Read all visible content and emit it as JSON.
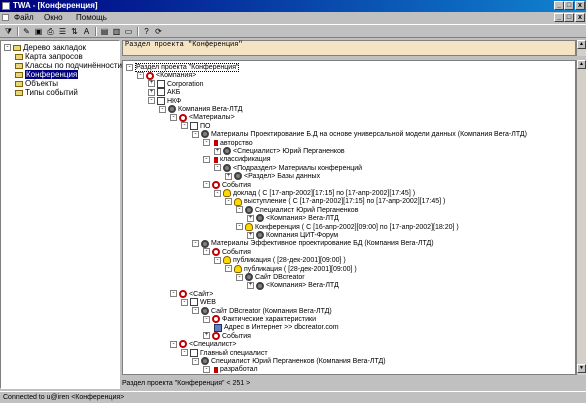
{
  "window": {
    "title": "TWA - [Конференция]",
    "min_label": "_",
    "max_label": "□",
    "close_label": "x"
  },
  "menu": [
    "Файл",
    "Окно",
    "Помощь"
  ],
  "toolbar_icons": [
    "filter-icon",
    "edit-icon",
    "save-icon",
    "print-icon",
    "properties-icon",
    "sort-icon",
    "text-icon",
    "split-horizontal-icon",
    "split-vertical-icon",
    "window-icon",
    "help-icon",
    "refresh-icon"
  ],
  "left_tree": {
    "root": "Дерево закладок",
    "items": [
      "Карта запросов",
      "Классы по подчинённости",
      "Конференция",
      "Объекты",
      "Типы событий"
    ]
  },
  "section_header": "Раздел проекта \"Конференция\"",
  "tree": [
    {
      "text": "Раздел проекта \"Конференция\"",
      "exp": "-",
      "icon": "none",
      "sel": true
    },
    {
      "text": "<Компания>",
      "exp": "-",
      "icon": "obj"
    },
    {
      "text": "Corporation",
      "exp": "+",
      "icon": "doc"
    },
    {
      "text": "АКБ",
      "exp": "+",
      "icon": "doc"
    },
    {
      "text": "НКФ",
      "exp": "-",
      "icon": "doc"
    },
    {
      "text": "Компания Вега-ЛТД",
      "exp": "-",
      "icon": "cog"
    },
    {
      "text": "<Материалы>",
      "exp": "-",
      "icon": "obj"
    },
    {
      "text": "ПО",
      "exp": "-",
      "icon": "doc"
    },
    {
      "text": "Материалы Проектирование Б.Д на основе универсальной модели данных (Компания Вега-ЛТД)",
      "exp": "-",
      "icon": "cog"
    },
    {
      "text": "авторство",
      "exp": "-",
      "icon": "tag"
    },
    {
      "text": "<Специалист> Юрий Перганенков",
      "exp": "+",
      "icon": "cog"
    },
    {
      "text": "классификация",
      "exp": "-",
      "icon": "tag"
    },
    {
      "text": "<Подраздел> Материалы конференций",
      "exp": "-",
      "icon": "cog"
    },
    {
      "text": "<Раздел> Базы данных",
      "exp": "+",
      "icon": "cog"
    },
    {
      "text": "События",
      "exp": "-",
      "icon": "obj"
    },
    {
      "text": "доклад ( С [17-апр-2002][17:15] по [17-апр-2002][17:45] )",
      "exp": "-",
      "icon": "bulb"
    },
    {
      "text": "выступление ( С [17-апр-2002][17:15] по [17-апр-2002][17:45] )",
      "exp": "-",
      "icon": "bulb"
    },
    {
      "text": "Специалист Юрий Перганенков",
      "exp": "-",
      "icon": "cog"
    },
    {
      "text": "<Компания> Вега-ЛТД",
      "exp": "+",
      "icon": "cog"
    },
    {
      "text": "Конференция ( С [16-апр-2002][09:00] по [17-апр-2002][18:20] )",
      "exp": "-",
      "icon": "bulb"
    },
    {
      "text": "Компания ЦИТ-Форум",
      "exp": "+",
      "icon": "cog"
    },
    {
      "text": "Материалы Эффективное проектирование БД (Компания Вега-ЛТД)",
      "exp": "-",
      "icon": "cog"
    },
    {
      "text": "События",
      "exp": "-",
      "icon": "obj"
    },
    {
      "text": "публикация ( [28-дек-2001][09:00] )",
      "exp": "-",
      "icon": "bulb"
    },
    {
      "text": "публикация ( [28-дек-2001][09:00] )",
      "exp": "-",
      "icon": "bulb"
    },
    {
      "text": "Сайт DBcreator",
      "exp": "-",
      "icon": "cog"
    },
    {
      "text": "<Компания> Вега-ЛТД",
      "exp": "+",
      "icon": "cog"
    },
    {
      "text": "<Сайт>",
      "exp": "-",
      "icon": "obj"
    },
    {
      "text": "WEB",
      "exp": "-",
      "icon": "doc"
    },
    {
      "text": "Сайт DBcreator (Компания Вега-ЛТД)",
      "exp": "-",
      "icon": "cog"
    },
    {
      "text": "Фактические характеристики",
      "exp": "-",
      "icon": "obj"
    },
    {
      "text": "Адрес в Интернет >> dbcreator.com",
      "exp": "",
      "icon": "card"
    },
    {
      "text": "События",
      "exp": "+",
      "icon": "obj"
    },
    {
      "text": "<Специалист>",
      "exp": "-",
      "icon": "obj"
    },
    {
      "text": "Главный специалист",
      "exp": "-",
      "icon": "doc"
    },
    {
      "text": "Специалист Юрий Перганенков (Компания Вега-ЛТД)",
      "exp": "-",
      "icon": "cog"
    },
    {
      "text": "разработал",
      "exp": "-",
      "icon": "tag"
    }
  ],
  "bottom_status": "Раздел проекта \"Конференция\" < 251 >",
  "statusbar": "Connected to u@iren <Конференция>"
}
